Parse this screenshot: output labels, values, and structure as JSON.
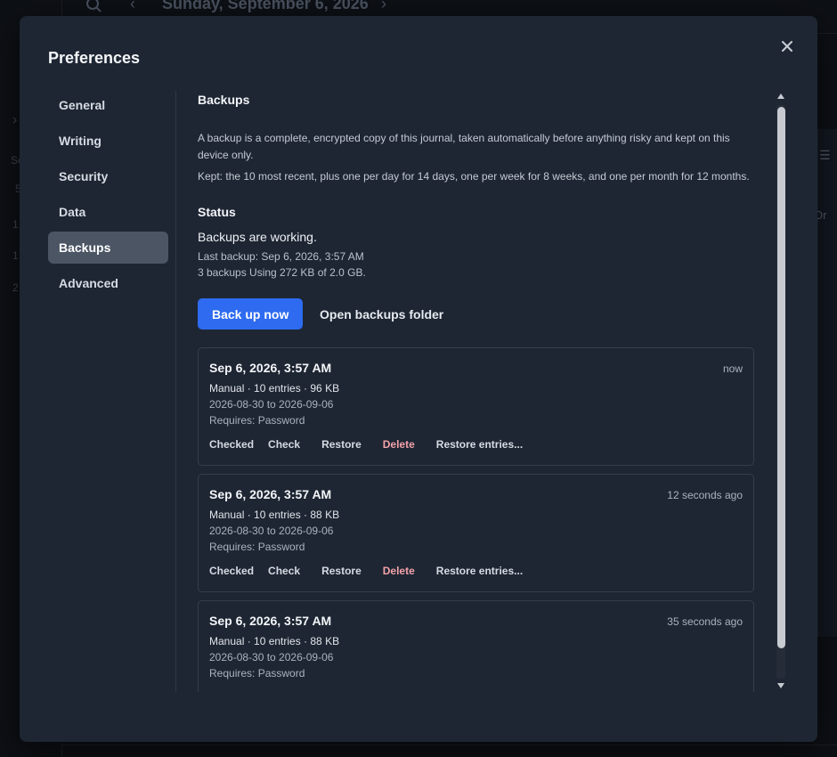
{
  "background": {
    "date_title": "Sunday, September 6, 2026",
    "fragments": [
      "Se",
      "5",
      "1",
      "1",
      "2"
    ],
    "right_text": "Or"
  },
  "modal": {
    "title": "Preferences"
  },
  "nav": {
    "items": [
      {
        "label": "General"
      },
      {
        "label": "Writing"
      },
      {
        "label": "Security"
      },
      {
        "label": "Data"
      },
      {
        "label": "Backups",
        "active": true
      },
      {
        "label": "Advanced"
      }
    ]
  },
  "backups": {
    "title": "Backups",
    "description": "A backup is a complete, encrypted copy of this journal, taken automatically before anything risky and kept on this device only.",
    "retention": "Kept: the 10 most recent, plus one per day for 14 days, one per week for 8 weeks, and one per month for 12 months.",
    "status_heading": "Status",
    "status_text": "Backups are working.",
    "last_backup": "Last backup: Sep 6, 2026, 3:57 AM",
    "usage": "3 backups Using 272 KB of 2.0 GB.",
    "backup_now_label": "Back up now",
    "open_folder_label": "Open backups folder",
    "list": [
      {
        "date": "Sep 6, 2026, 3:57 AM",
        "ago": "now",
        "meta": "Manual · 10 entries · 96 KB",
        "range": "2026-08-30 to 2026-09-06",
        "requires": "Requires: Password",
        "status": "Checked",
        "check": "Check",
        "restore": "Restore",
        "delete": "Delete",
        "restore_entries": "Restore entries..."
      },
      {
        "date": "Sep 6, 2026, 3:57 AM",
        "ago": "12 seconds ago",
        "meta": "Manual · 10 entries · 88 KB",
        "range": "2026-08-30 to 2026-09-06",
        "requires": "Requires: Password",
        "status": "Checked",
        "check": "Check",
        "restore": "Restore",
        "delete": "Delete",
        "restore_entries": "Restore entries..."
      },
      {
        "date": "Sep 6, 2026, 3:57 AM",
        "ago": "35 seconds ago",
        "meta": "Manual · 10 entries · 88 KB",
        "range": "2026-08-30 to 2026-09-06",
        "requires": "Requires: Password"
      }
    ]
  },
  "colors": {
    "modal_bg": "#1e2633",
    "accent": "#2e6bf0",
    "danger": "#f2a2a8",
    "nav_active": "#4b5564"
  },
  "icons": {
    "close": "close-icon",
    "search": "search-icon",
    "prev": "chevron-left-icon",
    "next": "chevron-right-icon"
  }
}
